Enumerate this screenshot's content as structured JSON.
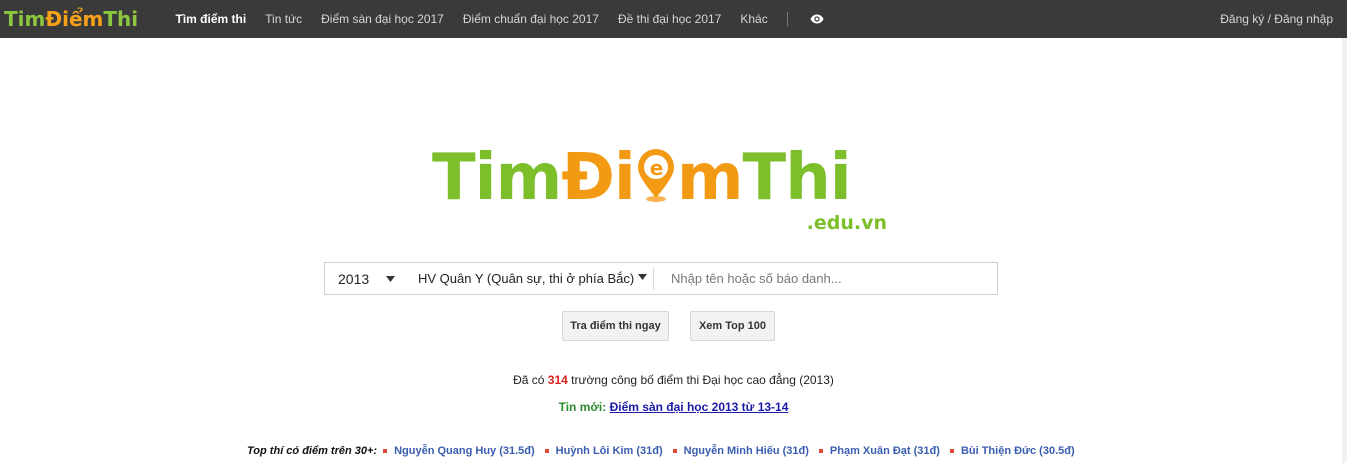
{
  "navbar": {
    "logo_part1": "Tim",
    "logo_part2": "Điểm",
    "logo_part3": "Thi",
    "items": [
      {
        "label": "Tìm điểm thi",
        "active": true
      },
      {
        "label": "Tin tức"
      },
      {
        "label": "Điểm sàn đại học 2017"
      },
      {
        "label": "Điểm chuẩn đại học 2017"
      },
      {
        "label": "Đề thi đại học 2017"
      },
      {
        "label": "Khác"
      }
    ],
    "icon": "eye-icon",
    "auth": "Đăng ký / Đăng nhập"
  },
  "logo": {
    "part1": "Tim",
    "part2a": "Đi",
    "part2b": "m",
    "part3": "Thi",
    "domain": ".edu.vn"
  },
  "search": {
    "year": "2013",
    "school": "HV Quân Y (Quân sự, thi ở phía Bắc)",
    "placeholder": "Nhập tên hoặc số báo danh..."
  },
  "buttons": {
    "search": "Tra điểm thi ngay",
    "top100": "Xem Top 100"
  },
  "info": {
    "prefix": "Đã có",
    "count": "314",
    "suffix": "trường công bố điểm thi Đại học cao đẳng (2013)"
  },
  "news": {
    "label": "Tin mới:",
    "link": "Điểm sàn đại học 2013 từ 13-14"
  },
  "top_students": {
    "label": "Top thí có điểm trên 30+:",
    "entries": [
      "Nguyễn Quang Huy (31.5đ)",
      "Huỳnh Lôi Kim (31đ)",
      "Nguyễn Minh Hiếu (31đ)",
      "Phạm Xuân Đạt (31đ)",
      "Bùi Thiện Đức (30.5đ)"
    ]
  },
  "colors": {
    "navbar_bg": "#3a3a3a",
    "logo_green": "#7cbf2a",
    "logo_orange": "#f39a14",
    "count_red": "#d9231d",
    "news_green": "#2e8b2e",
    "link_blue": "#1a1aa6",
    "name_blue": "#3a5db0"
  }
}
